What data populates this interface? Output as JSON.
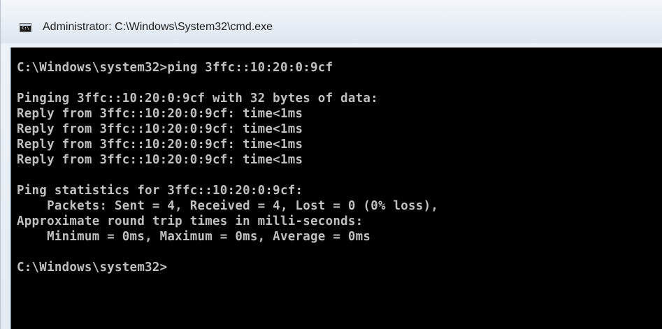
{
  "window": {
    "title": "Administrator: C:\\Windows\\System32\\cmd.exe",
    "icon": "cmd-console-icon",
    "icon_glyph": "C:\\"
  },
  "console": {
    "background": "#000000",
    "text_color": "#c0c0c0",
    "lines": [
      "C:\\Windows\\system32>ping 3ffc::10:20:0:9cf",
      "",
      "Pinging 3ffc::10:20:0:9cf with 32 bytes of data:",
      "Reply from 3ffc::10:20:0:9cf: time<1ms",
      "Reply from 3ffc::10:20:0:9cf: time<1ms",
      "Reply from 3ffc::10:20:0:9cf: time<1ms",
      "Reply from 3ffc::10:20:0:9cf: time<1ms",
      "",
      "Ping statistics for 3ffc::10:20:0:9cf:",
      "    Packets: Sent = 4, Received = 4, Lost = 0 (0% loss),",
      "Approximate round trip times in milli-seconds:",
      "    Minimum = 0ms, Maximum = 0ms, Average = 0ms",
      "",
      "C:\\Windows\\system32>"
    ]
  }
}
